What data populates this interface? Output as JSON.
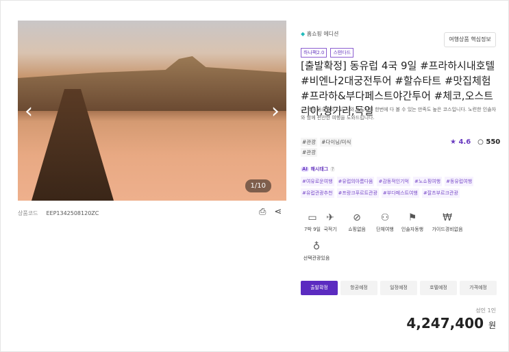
{
  "gallery": {
    "counter": "1/10",
    "prev": "‹",
    "next": "›"
  },
  "product_code": {
    "label": "상품코드",
    "value": "EEP1342508120ZC"
  },
  "shop_edition": "홈쇼핑 에디션",
  "key_info_button": "여행상품 핵심정보",
  "badges": [
    "하나팩2.0",
    "스탠다드"
  ],
  "title": "[출발확정] 동유럽 4국 9일 #프라하시내호텔 #비엔나2대궁전투어 #할슈타트 #맛집체험 #프라하&부다페스트야간투어 #체코,오스트리아,헝가리,독일",
  "description": "핵심 동유럽의 대도시와 소도시를 한번에 다 볼 수 있는 만족도 높은 코스입니다. 노련한 인솔자와 함께 편안한 여행을 도와드립니다.",
  "tags": [
    "#관광",
    "#다이닝/미식",
    "#관광"
  ],
  "rating": "4.6",
  "reviews": "550",
  "hashtag_label": "해시태그",
  "hashtag_help": "?",
  "ai_badge": "AI",
  "hashtags": [
    "#여유로운여행",
    "#유럽의아름다움",
    "#감동적인기억",
    "#노쇼핑여행",
    "#동유럽여행",
    "#유럽관광추천",
    "#프랑크푸르트관광",
    "#부다페스트여행",
    "#잘츠부르크관광"
  ],
  "features": [
    {
      "icon": "calendar-icon",
      "label": "7박 9일"
    },
    {
      "icon": "airplane-icon",
      "label": "국적기"
    },
    {
      "icon": "no-shopping-icon",
      "label": "쇼핑없음"
    },
    {
      "icon": "group-icon",
      "label": "단체여행"
    },
    {
      "icon": "guide-icon",
      "label": "인솔자동행"
    },
    {
      "icon": "no-guide-fee-icon",
      "label": "가이드경비없음"
    },
    {
      "icon": "balloon-icon",
      "label": "선택관광있음"
    }
  ],
  "status_tabs": [
    "출발확정",
    "항공예정",
    "일정예정",
    "호텔예정",
    "가격예정"
  ],
  "price": {
    "unit_label": "성인 1인",
    "amount": "4,247,400",
    "currency": "원"
  },
  "colors": {
    "accent": "#5b2bc0"
  }
}
